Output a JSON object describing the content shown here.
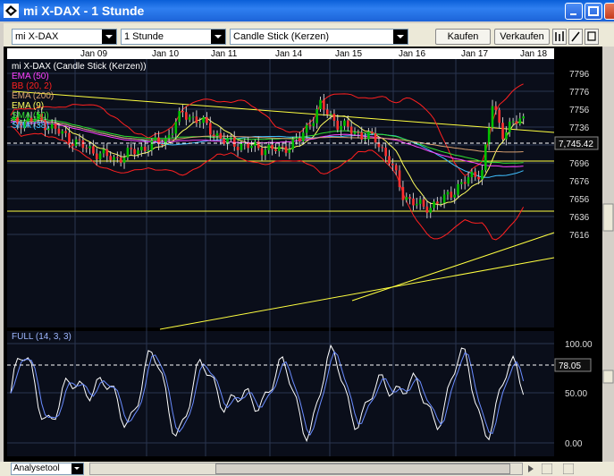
{
  "window": {
    "title": "mi X-DAX - 1 Stunde"
  },
  "toolbar": {
    "instrument": "mi X-DAX",
    "interval": "1 Stunde",
    "chart_type": "Candle Stick (Kerzen)",
    "buy_label": "Kaufen",
    "sell_label": "Verkaufen"
  },
  "chart": {
    "x_labels": [
      "Jan 09",
      "Jan 10",
      "Jan 11",
      "Jan 14",
      "Jan 15",
      "Jan 16",
      "Jan 17",
      "Jan 18"
    ],
    "y_ticks": [
      "7796",
      "7776",
      "7756",
      "7736",
      "7716",
      "7696",
      "7676",
      "7656",
      "7636",
      "7616"
    ],
    "last_price": "7,745.42",
    "legend": [
      {
        "label": "mi X-DAX (Candle Stick (Kerzen))",
        "color": "#ffffff"
      },
      {
        "label": "EMA (50)",
        "color": "#ff40ff"
      },
      {
        "label": "BB (20, 2)",
        "color": "#ff2020"
      },
      {
        "label": "EMA (200)",
        "color": "#d8a070"
      },
      {
        "label": "EMA (9)",
        "color": "#ffff60"
      },
      {
        "label": "SMA (50)",
        "color": "#30e030"
      },
      {
        "label": "SMA (38)",
        "color": "#40c0ff"
      }
    ],
    "colors": {
      "background": "#0a0e1a",
      "grid": "#2a3550",
      "candle_up": "#00c000",
      "candle_down": "#ff3030",
      "trendline": "#ffff40"
    }
  },
  "oscillator": {
    "label": "FULL (14, 3, 3)",
    "y_ticks": [
      "100.00",
      "50.00",
      "0.00"
    ],
    "last_value": "78.05"
  },
  "bottom": {
    "tool_select": "Analysetool"
  }
}
